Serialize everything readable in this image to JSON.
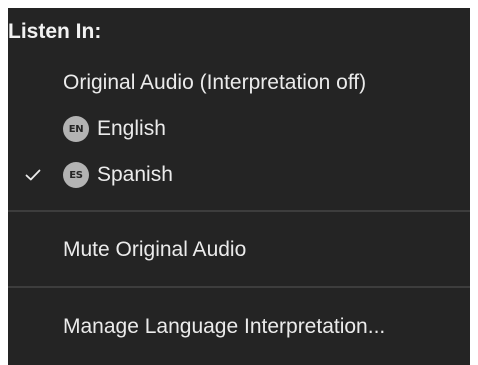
{
  "menu": {
    "header": "Listen In:",
    "items": [
      {
        "label": "Original Audio (Interpretation off)",
        "checked": false
      },
      {
        "label": "English",
        "badge": "EN",
        "checked": false
      },
      {
        "label": "Spanish",
        "badge": "ES",
        "checked": true
      }
    ],
    "mute_label": "Mute Original Audio",
    "manage_label": "Manage Language Interpretation..."
  },
  "colors": {
    "menu_background": "#242424",
    "text": "#ebebeb",
    "badge_background": "#b3b3b3",
    "divider": "#3d3d3d"
  },
  "icons": {
    "check": "checkmark-icon"
  }
}
